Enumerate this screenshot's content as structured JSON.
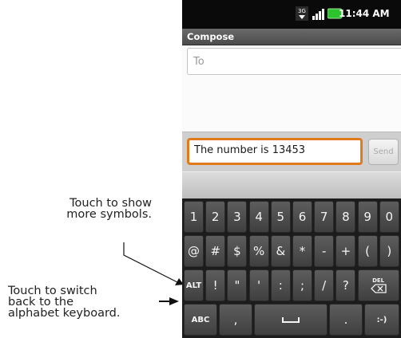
{
  "callouts": {
    "symbols": [
      "Touch to show",
      "more symbols."
    ],
    "switch": [
      "Touch to switch",
      "back to the",
      "alphabet keyboard."
    ]
  },
  "status": {
    "time": "11:44 AM",
    "network": "3G"
  },
  "titlebar": {
    "title": "Compose"
  },
  "compose": {
    "to_placeholder": "To"
  },
  "message": {
    "value": "The number is 13453",
    "send_label": "Send"
  },
  "keyboard": {
    "row1": [
      "1",
      "2",
      "3",
      "4",
      "5",
      "6",
      "7",
      "8",
      "9",
      "0"
    ],
    "row2": [
      "@",
      "#",
      "$",
      "%",
      "&",
      "*",
      "-",
      "+",
      "(",
      ")"
    ],
    "row3": [
      "ALT",
      "!",
      "\"",
      "'",
      ":",
      ";",
      "/",
      "?"
    ],
    "del_label": "DEL",
    "row4": {
      "abc": "ABC",
      "comma": ",",
      "period": ".",
      "smiley": ":-)"
    }
  }
}
